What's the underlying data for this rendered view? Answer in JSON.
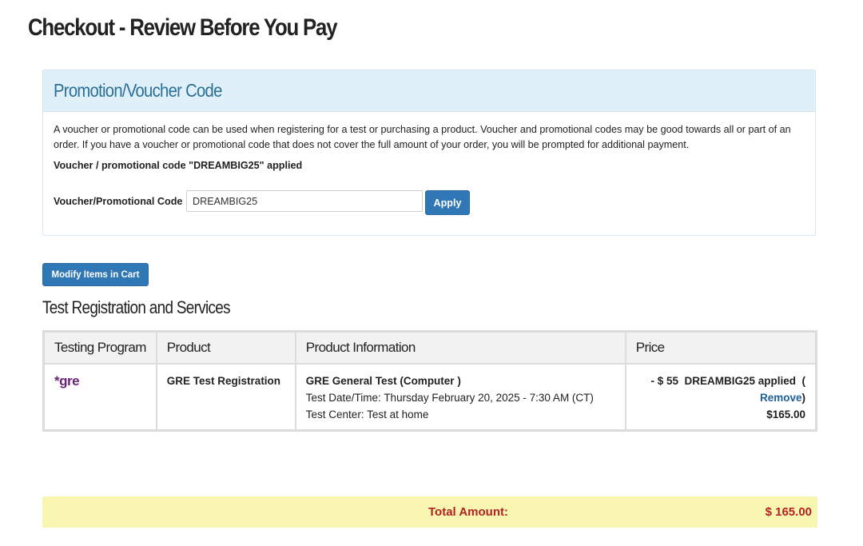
{
  "page": {
    "title": "Checkout - Review Before You Pay"
  },
  "promo": {
    "header": "Promotion/Voucher Code",
    "description": "A voucher or promotional code can be used when registering for a test or purchasing a product. Voucher and promotional codes may be good towards all or part of an order. If you have a voucher or promotional code that does not cover the full amount of your order, you will be prompted for additional payment.",
    "applied_message": "Voucher / promotional code \"DREAMBIG25\" applied",
    "field_label": "Voucher/Promotional Code",
    "field_value": "DREAMBIG25",
    "apply_label": "Apply"
  },
  "cart": {
    "modify_label": "Modify Items in Cart",
    "section_title": "Test Registration and Services",
    "columns": [
      "Testing Program",
      "Product",
      "Product Information",
      "Price"
    ],
    "rows": [
      {
        "program_logo_text": "*gre",
        "product": "GRE Test Registration",
        "info_title": "GRE General Test (Computer )",
        "info_date": "Test Date/Time: Thursday February 20, 2025 - 7:30 AM (CT)",
        "info_center": "Test Center: Test at home",
        "discount": "- $ 55  DREAMBIG25 applied  (",
        "remove_label": "Remove",
        "remove_close": ")",
        "price": "$165.00"
      }
    ]
  },
  "total": {
    "label": "Total Amount:",
    "value": "$ 165.00"
  },
  "colors": {
    "accent_button": "#2f77b5",
    "promo_header_bg": "#dff0f8",
    "promo_title": "#2a6f97",
    "total_bg": "#f8f6b0",
    "total_text": "#b22222",
    "gre_brand": "#6b2378"
  }
}
